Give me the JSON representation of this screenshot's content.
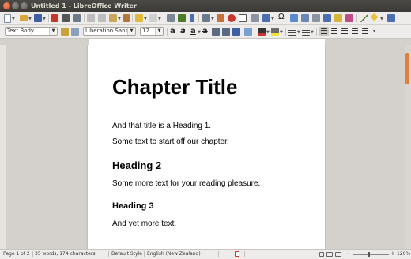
{
  "window": {
    "title": "Untitled 1 - LibreOffice Writer"
  },
  "formatting": {
    "paragraph_style": "Text Body",
    "font_name": "Liberation Sans",
    "font_size": "12"
  },
  "document": {
    "chapter_title": "Chapter Title",
    "paragraphs": [
      "And that title is a Heading 1.",
      "Some text to start off our chapter."
    ],
    "heading2": "Heading 2",
    "paragraph2": "Some more text for your reading pleasure.",
    "heading3": "Heading 3",
    "paragraph3": "And yet more text."
  },
  "status": {
    "page": "Page 1 of 2",
    "words": "35 words, 174 characters",
    "page_style": "Default Style",
    "language": "English (New Zealand)",
    "zoom": "120%"
  },
  "colors": {
    "accent": "#e2803b",
    "titlebar": "#3c3b37",
    "close_button": "#e2511f"
  }
}
